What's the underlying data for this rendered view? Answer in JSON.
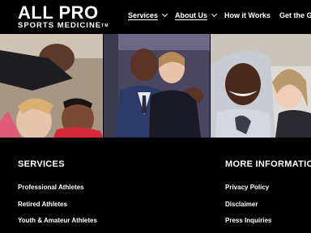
{
  "brand": {
    "name_main": "ALL PRO",
    "name_sub": "SPORTS MEDICINE",
    "trademark": "TM"
  },
  "nav": {
    "items": [
      {
        "label": "Services",
        "has_dropdown": true
      },
      {
        "label": "About Us",
        "has_dropdown": true
      },
      {
        "label": "How it Works",
        "has_dropdown": false
      },
      {
        "label": "Get the G",
        "has_dropdown": false
      }
    ]
  },
  "footer": {
    "services": {
      "title": "SERVICES",
      "links": [
        "Professional Athletes",
        "Retired Athletes",
        "Youth & Amateur Athletes"
      ]
    },
    "more_info": {
      "title": "MORE INFORMATIO",
      "links": [
        "Privacy Policy",
        "Disclaimer",
        "Press Inquiries"
      ]
    }
  }
}
